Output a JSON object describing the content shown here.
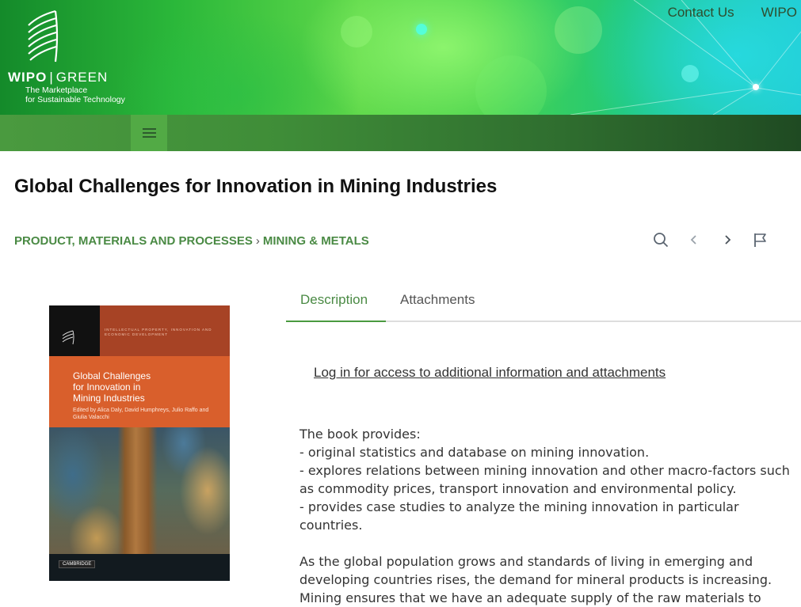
{
  "header": {
    "top_links": [
      "Contact Us",
      "WIPO"
    ],
    "logo": {
      "word_left": "WIPO",
      "word_right": "GREEN",
      "tagline_line1": "The Marketplace",
      "tagline_line2": "for Sustainable Technology"
    }
  },
  "page": {
    "title": "Global Challenges for Innovation in Mining Industries"
  },
  "breadcrumb": {
    "items": [
      "PRODUCT, MATERIALS AND PROCESSES",
      "MINING & METALS"
    ]
  },
  "toolbar": {
    "icons": [
      "search-icon",
      "chevron-left-icon",
      "chevron-right-icon",
      "flag-icon"
    ]
  },
  "cover": {
    "series": "INTELLECTUAL PROPERTY, INNOVATION AND ECONOMIC DEVELOPMENT",
    "title_line1": "Global Challenges",
    "title_line2": "for Innovation in",
    "title_line3": "Mining Industries",
    "editors": "Edited by Alica Daly, David Humphreys, Julio Raffo and Giulia Valacchi",
    "publisher": "CAMBRIDGE"
  },
  "tabs": [
    "Description",
    "Attachments"
  ],
  "content": {
    "login_link": "Log in for access to additional information and attachments",
    "lines": [
      "The book provides:",
      "- original statistics and database on mining innovation.",
      "- explores relations between mining innovation and other macro-factors such as commodity prices, transport innovation and environmental policy.",
      "- provides case studies to analyze the mining innovation in particular countries."
    ],
    "paragraph2": "As the global population grows and standards of living in emerging and developing countries rises, the demand for mineral products is increasing. Mining ensures that we have an adequate supply of the raw materials to"
  },
  "colors": {
    "brand_green": "#4a8a44",
    "nav_green": "#3f8d38",
    "tab_accent": "#4a9a3f"
  }
}
